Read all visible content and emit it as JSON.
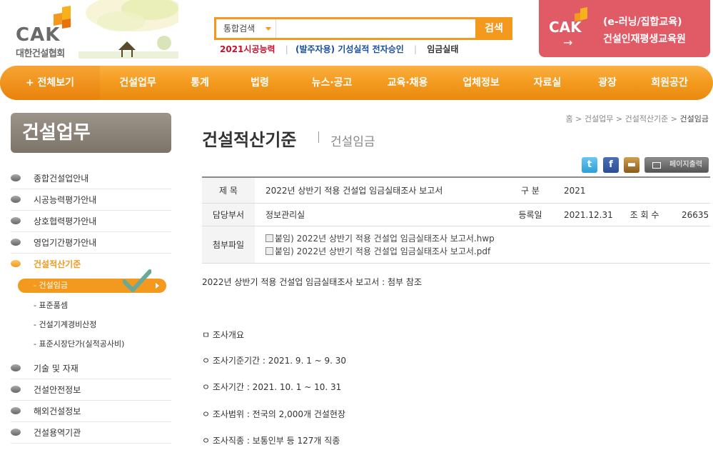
{
  "header": {
    "logo_text": "CAK",
    "logo_sub": "대한건설협회",
    "search": {
      "category": "통합검색",
      "value": "",
      "button": "검색"
    },
    "quick_links": [
      "2021시공능력",
      "(발주자용) 기성실적 전자승인",
      "임금실태"
    ],
    "promo": {
      "logo": "CAK",
      "arrow": "→",
      "line1": "(e-러닝/집합교육)",
      "line2": "건설인재평생교육원"
    }
  },
  "nav": {
    "all": "+ 전체보기",
    "items": [
      "건설업무",
      "통계",
      "법령",
      "뉴스·공고",
      "교육·채용",
      "업체정보",
      "자료실",
      "광장",
      "회원공간"
    ]
  },
  "sidebar": {
    "title": "건설업무",
    "items": [
      "종합건설업안내",
      "시공능력평가안내",
      "상호협력평가안내",
      "영업기간평가안내",
      "건설적산기준"
    ],
    "subitems": [
      "- 건설임금",
      "- 표준품셈",
      "- 건설기계경비산정",
      "- 표준시장단가(실적공사비)"
    ],
    "items_after": [
      "기술 및 자재",
      "건설안전정보",
      "해외건설정보",
      "건설용역기관"
    ]
  },
  "breadcrumb": {
    "path": "홈 > 건설업무 > 건설적산기준 >",
    "current": "건설임금"
  },
  "page": {
    "title": "건설적산기준",
    "subtitle": "건설임금"
  },
  "tools": {
    "print": "페이지출력"
  },
  "info": {
    "labels": {
      "title": "제      목",
      "category": "구    분",
      "dept": "담당부서",
      "regdate": "등록일",
      "views": "조 회 수",
      "attach": "첨부파일"
    },
    "title": "2022년 상반기 적용 건설업 임금실태조사 보고서",
    "category": "2021",
    "dept": "정보관리실",
    "regdate": "2021.12.31",
    "views": "26635",
    "files": [
      "붙임) 2022년 상반기 적용 건설업 임금실태조사 보고서.hwp",
      "붙임) 2022년 상반기 적용 건설업 임금실태조사 보고서.pdf"
    ]
  },
  "content": {
    "intro": "2022년 상반기 적용 건설업 임금실태조사 보고서 : 첨부 참조",
    "section": "ㅁ 조사개요",
    "lines": [
      "ㅇ 조사기준기간 : 2021. 9. 1  ~  9. 30",
      "ㅇ 조사기간 : 2021. 10. 1  ~  10. 31",
      "ㅇ 조사범위 : 전국의 2,000개 건설현장",
      "ㅇ 조사직종 : 보통인부 등 127개 직종"
    ]
  },
  "colors": {
    "accent": "#f39a1e",
    "promo": "#e05b66",
    "sidebar_title": "#8a8277"
  }
}
